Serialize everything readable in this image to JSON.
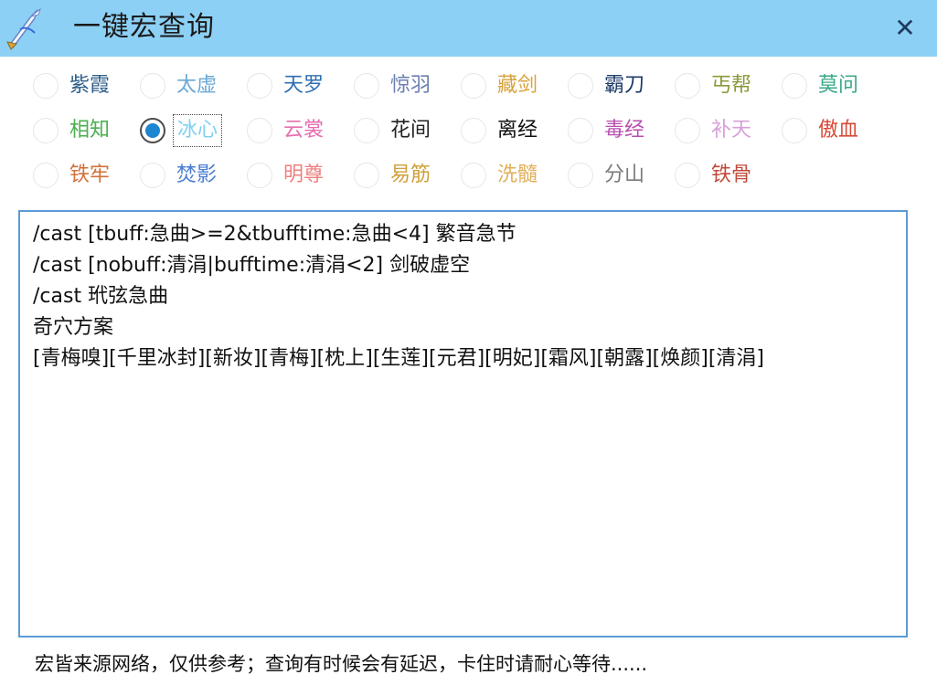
{
  "window": {
    "title": "一键宏查询",
    "close_label": "✕"
  },
  "schools": [
    {
      "label": "紫霞",
      "color": "#2e5f8a"
    },
    {
      "label": "太虚",
      "color": "#6aa9d8"
    },
    {
      "label": "天罗",
      "color": "#2f6fb0"
    },
    {
      "label": "惊羽",
      "color": "#6b7fb0"
    },
    {
      "label": "藏剑",
      "color": "#d8a23a"
    },
    {
      "label": "霸刀",
      "color": "#1f3b6a"
    },
    {
      "label": "丐帮",
      "color": "#8a9a3a"
    },
    {
      "label": "莫问",
      "color": "#3aa88a"
    },
    {
      "label": "相知",
      "color": "#4caf50"
    },
    {
      "label": "冰心",
      "color": "#7fd0f0"
    },
    {
      "label": "云裳",
      "color": "#e66fb0"
    },
    {
      "label": "花间",
      "color": "#222222"
    },
    {
      "label": "离经",
      "color": "#111111"
    },
    {
      "label": "毒经",
      "color": "#b84fb0"
    },
    {
      "label": "补天",
      "color": "#d8a0d8"
    },
    {
      "label": "傲血",
      "color": "#d84a3a"
    },
    {
      "label": "铁牢",
      "color": "#d0703a"
    },
    {
      "label": "焚影",
      "color": "#4a7fd0"
    },
    {
      "label": "明尊",
      "color": "#f07f7f"
    },
    {
      "label": "易筋",
      "color": "#d0a03a"
    },
    {
      "label": "洗髓",
      "color": "#e0b05a"
    },
    {
      "label": "分山",
      "color": "#7a7a7a"
    },
    {
      "label": "铁骨",
      "color": "#c04a3a"
    }
  ],
  "selected_school": "冰心",
  "macro_lines": [
    "/cast [tbuff:急曲>=2&tbufftime:急曲<4] 繁音急节",
    "/cast [nobuff:清涓|bufftime:清涓<2] 剑破虚空",
    "/cast 玳弦急曲",
    "奇穴方案",
    "[青梅嗅][千里冰封][新妆][青梅][枕上][生莲][元君][明妃][霜风][朝露][焕颜][清涓]"
  ],
  "footer_note": "宏皆来源网络，仅供参考；查询有时候会有延迟，卡住时请耐心等待......",
  "colors": {
    "titlebar": "#8dd0f5",
    "textbox_border": "#5b9bd5",
    "radio_dot": "#1c86d1"
  }
}
